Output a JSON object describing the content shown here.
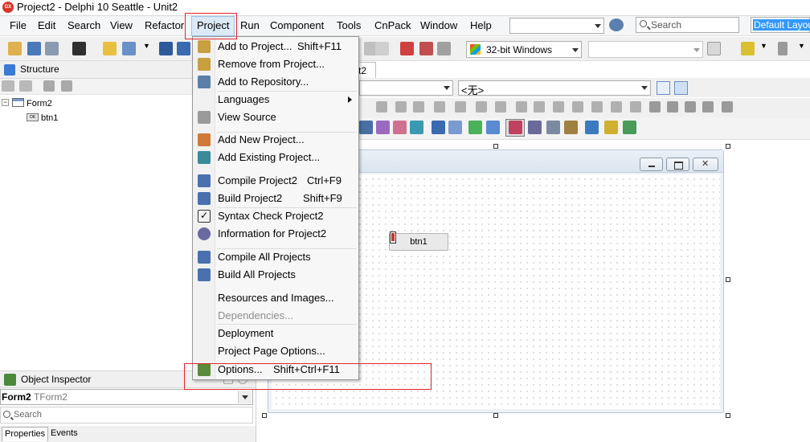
{
  "window": {
    "title": "Project2 - Delphi 10 Seattle - Unit2",
    "logo_text": "DX"
  },
  "menubar": {
    "items": [
      "File",
      "Edit",
      "Search",
      "View",
      "Refactor",
      "Project",
      "Run",
      "Component",
      "Tools",
      "CnPack",
      "Window",
      "Help"
    ],
    "active": "Project",
    "search_placeholder": "Search",
    "layout_value": "Default Layout"
  },
  "toolbar": {
    "platform": "32-bit Windows"
  },
  "structure": {
    "title": "Structure",
    "tree": [
      {
        "label": "Form2",
        "expander": "−"
      },
      {
        "label": "btn1",
        "icon_text": "OK"
      }
    ]
  },
  "object_inspector": {
    "title": "Object Inspector",
    "selected_name": "Form2",
    "selected_type": "TForm2",
    "search_placeholder": "Search",
    "tabs": [
      "Properties",
      "Events"
    ]
  },
  "designer": {
    "unit_tab": "Unit2",
    "combo_value": "<无>",
    "button_caption": "btn1"
  },
  "project_menu": {
    "items": [
      {
        "label": "Add to Project...",
        "shortcut": "Shift+F11",
        "icon": "add-to-project-icon",
        "color": "#c8a040"
      },
      {
        "label": "Remove from Project...",
        "shortcut": "",
        "icon": "remove-from-project-icon",
        "color": "#c8a040"
      },
      {
        "label": "Add to Repository...",
        "shortcut": "",
        "icon": "add-to-repository-icon",
        "color": "#5b7fa8"
      },
      {
        "label": "Languages",
        "shortcut": "",
        "icon": "",
        "submenu": true
      },
      {
        "label": "View Source",
        "shortcut": "",
        "icon": "view-source-icon",
        "color": "#9a9a9a"
      },
      {
        "separator": true
      },
      {
        "label": "Add New Project...",
        "shortcut": "",
        "icon": "add-new-project-icon",
        "color": "#d07a3a"
      },
      {
        "label": "Add Existing Project...",
        "shortcut": "",
        "icon": "add-existing-project-icon",
        "color": "#3a8a9a"
      },
      {
        "separator": true
      },
      {
        "label": "Compile Project2",
        "shortcut": "Ctrl+F9",
        "icon": "compile-icon",
        "color": "#4a70b0"
      },
      {
        "label": "Build Project2",
        "shortcut": "Shift+F9",
        "icon": "build-icon",
        "color": "#4a70b0"
      },
      {
        "label": "Syntax Check Project2",
        "shortcut": "",
        "icon": "syntax-check-icon",
        "color": "#333333"
      },
      {
        "label": "Information for Project2",
        "shortcut": "",
        "icon": "information-icon",
        "color": "#6a6aa0"
      },
      {
        "separator": true
      },
      {
        "label": "Compile All Projects",
        "shortcut": "",
        "icon": "compile-all-icon",
        "color": "#4a70b0"
      },
      {
        "label": "Build All Projects",
        "shortcut": "",
        "icon": "build-all-icon",
        "color": "#4a70b0"
      },
      {
        "separator": true
      },
      {
        "label": "Resources and Images...",
        "shortcut": "",
        "icon": ""
      },
      {
        "label": "Dependencies...",
        "shortcut": "",
        "icon": "",
        "disabled": true
      },
      {
        "label": "Deployment",
        "shortcut": "",
        "icon": ""
      },
      {
        "label": "Project Page Options...",
        "shortcut": "",
        "icon": ""
      },
      {
        "separator": true
      },
      {
        "label": "Options...",
        "shortcut": "Shift+Ctrl+F11",
        "icon": "options-icon",
        "color": "#5a8a3a"
      }
    ]
  },
  "colors": {
    "menu_highlight_border": "#e0252b",
    "menu_active_bg": "#dceaf7",
    "selection_blue": "#3399ff"
  }
}
